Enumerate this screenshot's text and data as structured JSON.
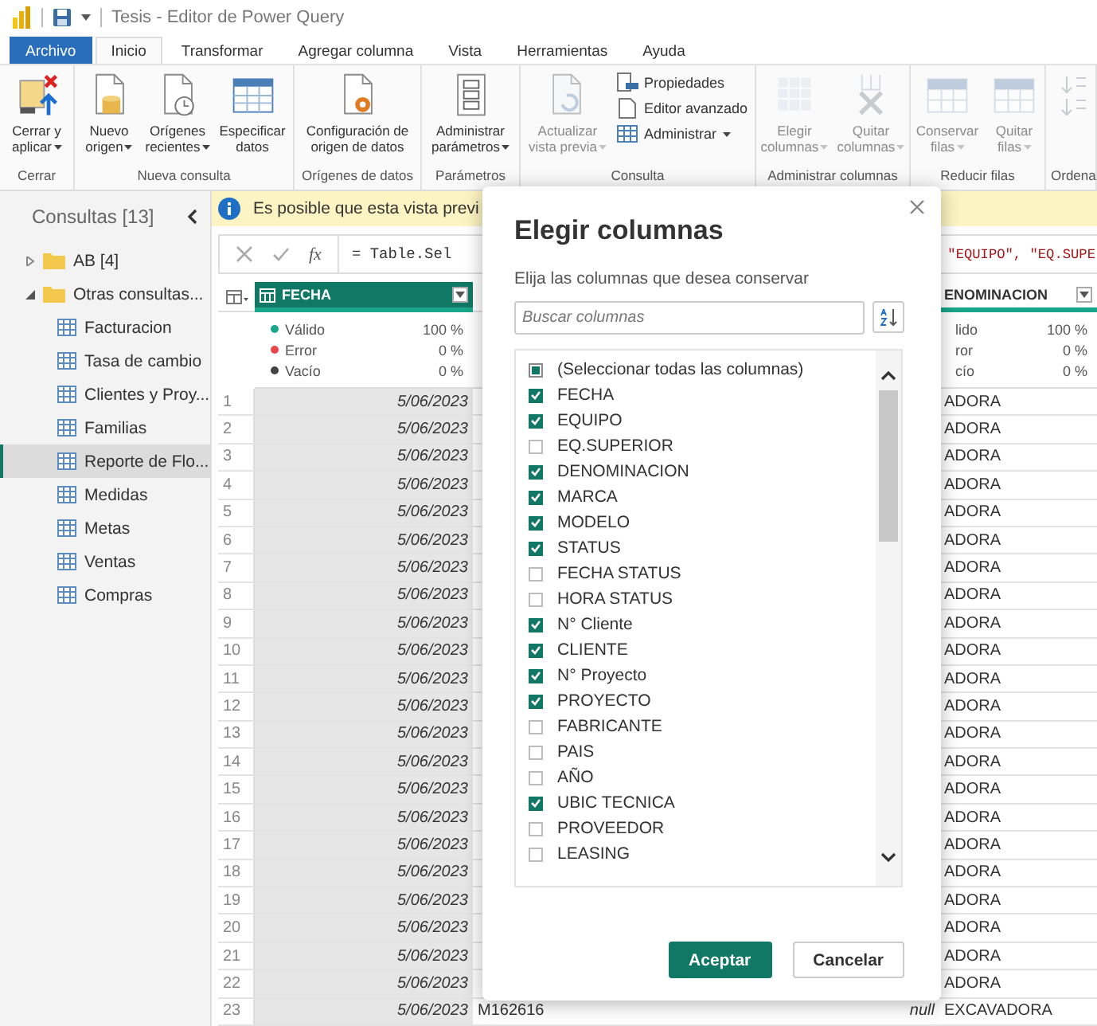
{
  "window": {
    "title": "Tesis - Editor de Power Query"
  },
  "menu_tabs": [
    {
      "label": "Archivo",
      "kind": "file",
      "selected": false
    },
    {
      "label": "Inicio",
      "kind": "tab",
      "selected": true
    },
    {
      "label": "Transformar",
      "kind": "tab",
      "selected": false
    },
    {
      "label": "Agregar columna",
      "kind": "tab",
      "selected": false
    },
    {
      "label": "Vista",
      "kind": "tab",
      "selected": false
    },
    {
      "label": "Herramientas",
      "kind": "tab",
      "selected": false
    },
    {
      "label": "Ayuda",
      "kind": "tab",
      "selected": false
    }
  ],
  "ribbon": {
    "groups": [
      {
        "label": "Cerrar",
        "buttons": [
          {
            "label": "Cerrar y aplicar",
            "kind": "large",
            "menu": true,
            "disabled": false
          }
        ]
      },
      {
        "label": "Nueva consulta",
        "buttons": [
          {
            "label": "Nuevo origen",
            "kind": "large",
            "menu": true,
            "disabled": false
          },
          {
            "label": "Orígenes recientes",
            "kind": "large",
            "menu": true,
            "disabled": false
          },
          {
            "label": "Especificar datos",
            "kind": "large",
            "menu": false,
            "disabled": false
          }
        ]
      },
      {
        "label": "Orígenes de datos",
        "buttons": [
          {
            "label": "Configuración de origen de datos",
            "kind": "large",
            "menu": false,
            "disabled": false
          }
        ]
      },
      {
        "label": "Parámetros",
        "buttons": [
          {
            "label": "Administrar parámetros",
            "kind": "large",
            "menu": true,
            "disabled": false
          }
        ]
      },
      {
        "label": "Consulta",
        "buttons": [
          {
            "label": "Actualizar vista previa",
            "kind": "large",
            "menu": true,
            "disabled": true
          },
          {
            "label": "Propiedades",
            "kind": "small",
            "menu": false,
            "disabled": false
          },
          {
            "label": "Editor avanzado",
            "kind": "small",
            "menu": false,
            "disabled": false
          },
          {
            "label": "Administrar",
            "kind": "small",
            "menu": true,
            "disabled": false
          }
        ]
      },
      {
        "label": "Administrar columnas",
        "buttons": [
          {
            "label": "Elegir columnas",
            "kind": "large",
            "menu": true,
            "disabled": true
          },
          {
            "label": "Quitar columnas",
            "kind": "large",
            "menu": true,
            "disabled": true
          }
        ]
      },
      {
        "label": "Reducir filas",
        "buttons": [
          {
            "label": "Conservar filas",
            "kind": "large",
            "menu": true,
            "disabled": true
          },
          {
            "label": "Quitar filas",
            "kind": "large",
            "menu": true,
            "disabled": true
          }
        ]
      },
      {
        "label": "Ordena",
        "buttons": [
          {
            "kind": "icon",
            "disabled": true
          }
        ]
      }
    ]
  },
  "queries": {
    "title": "Consultas [13]",
    "tree": [
      {
        "label": "AB [4]",
        "expanded": false,
        "selected": false
      },
      {
        "label": "Otras consultas...",
        "expanded": true,
        "selected": false,
        "children": [
          {
            "label": "Facturacion",
            "selected": false
          },
          {
            "label": "Tasa de cambio",
            "selected": false
          },
          {
            "label": "Clientes y Proy...",
            "selected": false
          },
          {
            "label": "Familias",
            "selected": false
          },
          {
            "label": "Reporte de Flo...",
            "selected": true
          },
          {
            "label": "Medidas",
            "selected": false
          },
          {
            "label": "Metas",
            "selected": false
          },
          {
            "label": "Ventas",
            "selected": false
          },
          {
            "label": "Compras",
            "selected": false
          }
        ]
      }
    ]
  },
  "grid": {
    "info": "Es posible que esta vista previ",
    "fx_label": "fx",
    "formula": "= Table.Sel",
    "formula_tail": "\"EQUIPO\", \"EQ.SUPE",
    "columns": [
      {
        "label": "FECHA",
        "selected": true,
        "quality": [
          {
            "label": "Válido",
            "value": "100 %",
            "color": "#1aa68a"
          },
          {
            "label": "Error",
            "value": "0 %",
            "color": "#e8484b"
          },
          {
            "label": "Vacío",
            "value": "0 %",
            "color": "#444444"
          }
        ]
      },
      {
        "label": "ENOMINACION",
        "selected": false,
        "quality": [
          {
            "label": "lido",
            "value": "100 %"
          },
          {
            "label": "ror",
            "value": "0 %"
          },
          {
            "label": "cío",
            "value": "0 %"
          }
        ]
      }
    ],
    "rows": [
      {
        "number": "1",
        "fecha": "5/06/2023",
        "column_4": "ADORA"
      },
      {
        "number": "2",
        "fecha": "5/06/2023",
        "column_4": "ADORA"
      },
      {
        "number": "3",
        "fecha": "5/06/2023",
        "column_4": "ADORA"
      },
      {
        "number": "4",
        "fecha": "5/06/2023",
        "column_4": "ADORA"
      },
      {
        "number": "5",
        "fecha": "5/06/2023",
        "column_4": "ADORA"
      },
      {
        "number": "6",
        "fecha": "5/06/2023",
        "column_4": "ADORA"
      },
      {
        "number": "7",
        "fecha": "5/06/2023",
        "column_4": "ADORA"
      },
      {
        "number": "8",
        "fecha": "5/06/2023",
        "column_4": "ADORA"
      },
      {
        "number": "9",
        "fecha": "5/06/2023",
        "column_4": "ADORA"
      },
      {
        "number": "10",
        "fecha": "5/06/2023",
        "column_4": "ADORA"
      },
      {
        "number": "11",
        "fecha": "5/06/2023",
        "column_4": "ADORA"
      },
      {
        "number": "12",
        "fecha": "5/06/2023",
        "column_4": "ADORA"
      },
      {
        "number": "13",
        "fecha": "5/06/2023",
        "column_4": "ADORA"
      },
      {
        "number": "14",
        "fecha": "5/06/2023",
        "column_4": "ADORA"
      },
      {
        "number": "15",
        "fecha": "5/06/2023",
        "column_4": "ADORA"
      },
      {
        "number": "16",
        "fecha": "5/06/2023",
        "column_4": "ADORA"
      },
      {
        "number": "17",
        "fecha": "5/06/2023",
        "column_4": "ADORA"
      },
      {
        "number": "18",
        "fecha": "5/06/2023",
        "column_4": "ADORA"
      },
      {
        "number": "19",
        "fecha": "5/06/2023",
        "column_4": "ADORA"
      },
      {
        "number": "20",
        "fecha": "5/06/2023",
        "column_4": "ADORA"
      },
      {
        "number": "21",
        "fecha": "5/06/2023",
        "column_4": "ADORA"
      },
      {
        "number": "22",
        "fecha": "5/06/2023",
        "column_4": "ADORA"
      },
      {
        "number": "23",
        "fecha": "5/06/2023",
        "column_2": "M162616",
        "column_3": "null",
        "column_4": "EXCAVADORA"
      }
    ]
  },
  "dialog": {
    "title": "Elegir columnas",
    "subtitle": "Elija las columnas que desea conservar",
    "search": {
      "placeholder": "Buscar columnas"
    },
    "columns": [
      {
        "label": "(Seleccionar todas las columnas)",
        "checked": false,
        "indeterminate": true
      },
      {
        "label": "FECHA",
        "checked": true,
        "indeterminate": false
      },
      {
        "label": "EQUIPO",
        "checked": true,
        "indeterminate": false
      },
      {
        "label": "EQ.SUPERIOR",
        "checked": false,
        "indeterminate": false
      },
      {
        "label": "DENOMINACION",
        "checked": true,
        "indeterminate": false
      },
      {
        "label": "MARCA",
        "checked": true,
        "indeterminate": false
      },
      {
        "label": "MODELO",
        "checked": true,
        "indeterminate": false
      },
      {
        "label": "STATUS",
        "checked": true,
        "indeterminate": false
      },
      {
        "label": "FECHA STATUS",
        "checked": false,
        "indeterminate": false
      },
      {
        "label": "HORA STATUS",
        "checked": false,
        "indeterminate": false
      },
      {
        "label": "N° Cliente",
        "checked": true,
        "indeterminate": false
      },
      {
        "label": "CLIENTE",
        "checked": true,
        "indeterminate": false
      },
      {
        "label": "N° Proyecto",
        "checked": true,
        "indeterminate": false
      },
      {
        "label": "PROYECTO",
        "checked": true,
        "indeterminate": false
      },
      {
        "label": "FABRICANTE",
        "checked": false,
        "indeterminate": false
      },
      {
        "label": "PAIS",
        "checked": false,
        "indeterminate": false
      },
      {
        "label": "AÑO",
        "checked": false,
        "indeterminate": false
      },
      {
        "label": "UBIC TECNICA",
        "checked": true,
        "indeterminate": false
      },
      {
        "label": "PROVEEDOR",
        "checked": false,
        "indeterminate": false
      },
      {
        "label": "LEASING",
        "checked": false,
        "indeterminate": false
      }
    ],
    "buttons": [
      {
        "label": "Aceptar",
        "kind": "primary"
      },
      {
        "label": "Cancelar",
        "kind": "secondary"
      }
    ]
  }
}
